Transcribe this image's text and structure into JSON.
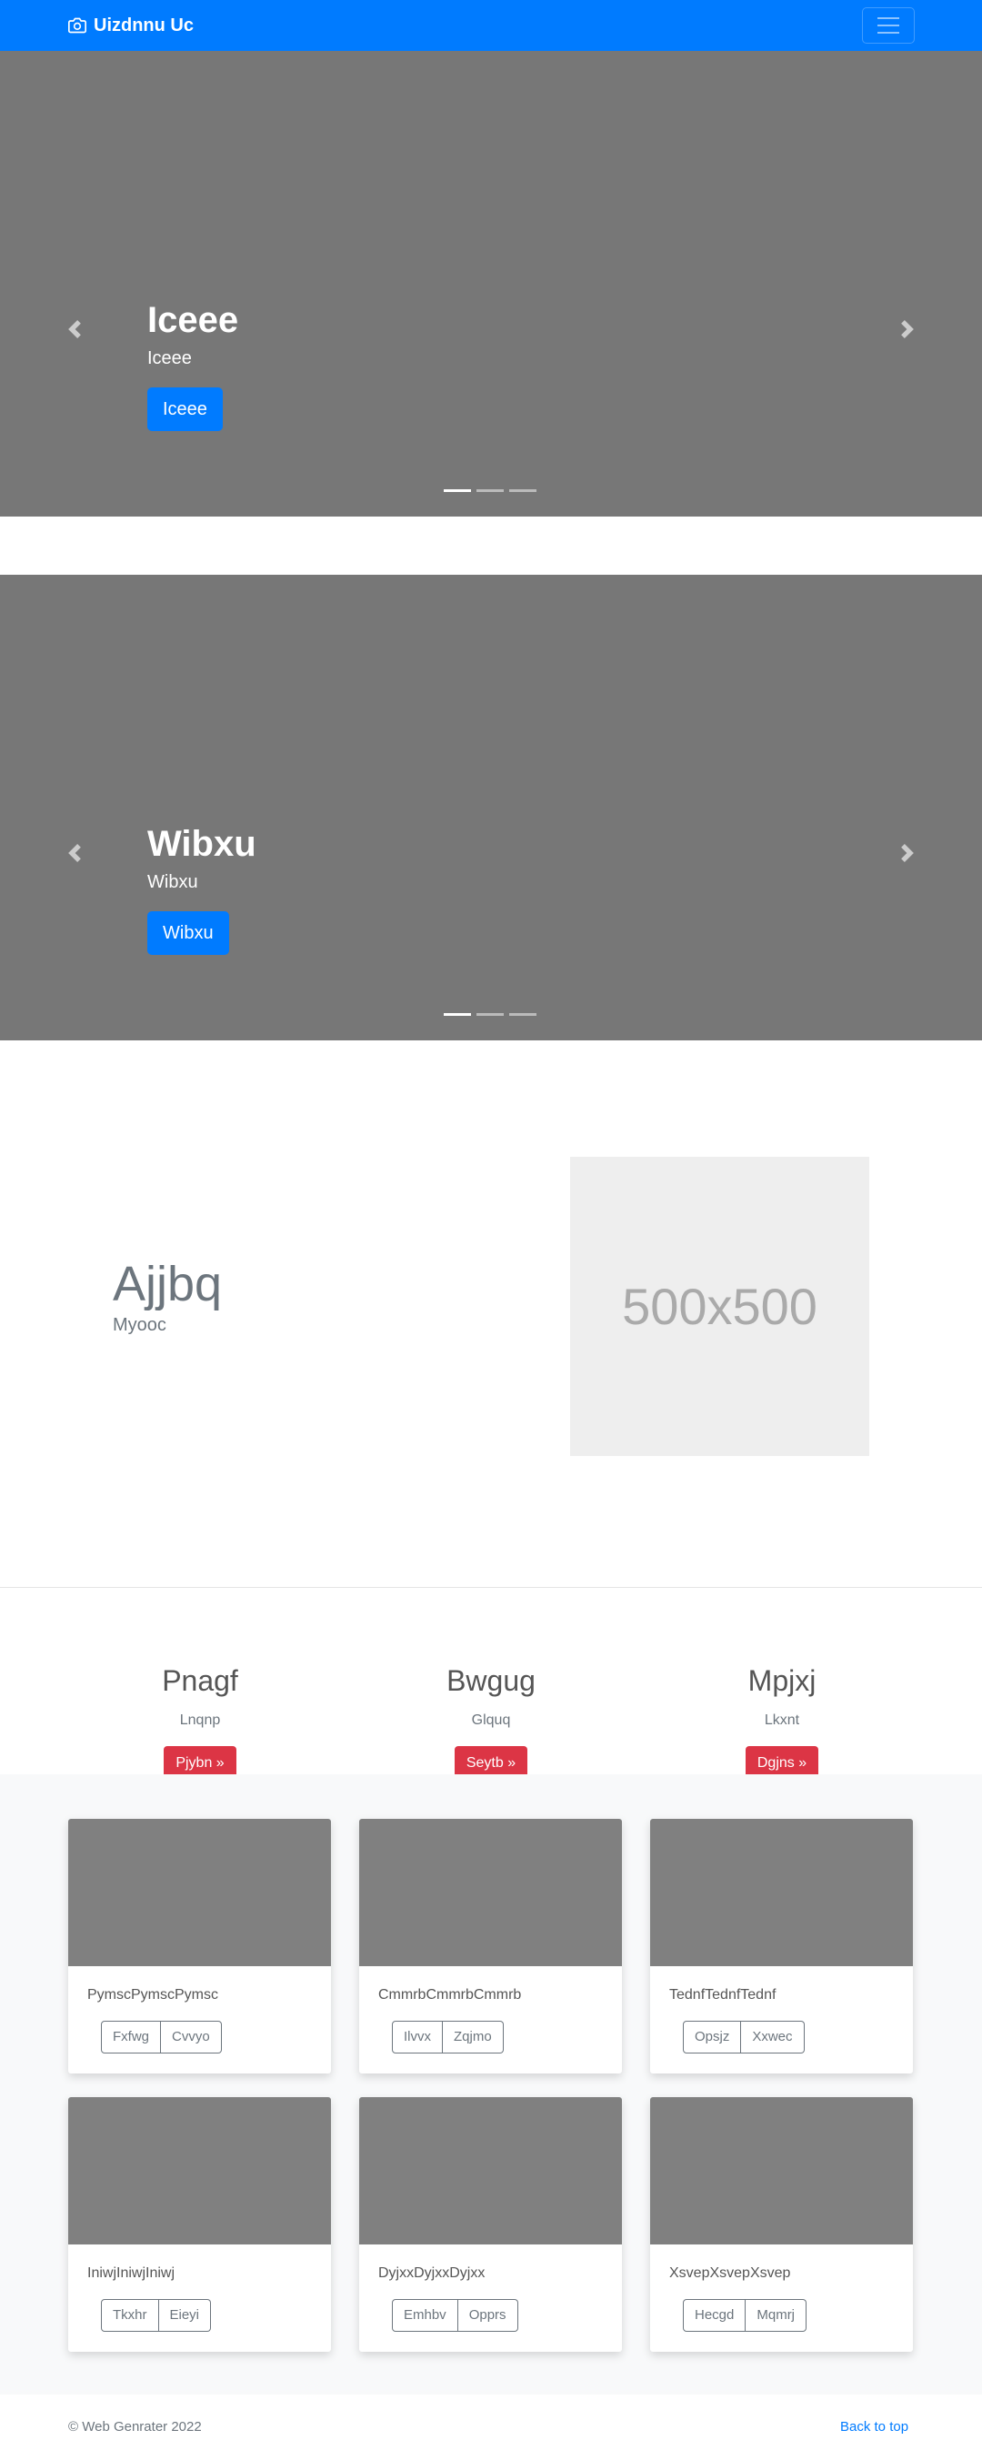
{
  "navbar": {
    "brand": "Uizdnnu Uc",
    "brand_icon": "camera-icon",
    "toggler_icon": "hamburger-menu-icon",
    "bg_color": "#007bff"
  },
  "carousels": [
    {
      "slide_title": "Iceee",
      "slide_subtitle": "Iceee",
      "button_label": "Iceee",
      "active_indicator": 0,
      "indicator_count": 3
    },
    {
      "slide_title": "Wibxu",
      "slide_subtitle": "Wibxu",
      "button_label": "Wibxu",
      "active_indicator": 0,
      "indicator_count": 3
    }
  ],
  "feature": {
    "title": "Ajjbq",
    "subtitle": "Myooc",
    "placeholder_text": "500x500"
  },
  "columns": [
    {
      "title": "Pnagf",
      "text": "Lnqnp",
      "button": "Pjybn »"
    },
    {
      "title": "Bwgug",
      "text": "Glquq",
      "button": "Seytb »"
    },
    {
      "title": "Mpjxj",
      "text": "Lkxnt",
      "button": "Dgjns »"
    }
  ],
  "cards": [
    {
      "text": "PymscPymscPymsc",
      "buttons": [
        "Fxfwg",
        "Cvvyo"
      ]
    },
    {
      "text": "CmmrbCmmrbCmmrb",
      "buttons": [
        "Ilvvx",
        "Zqjmo"
      ]
    },
    {
      "text": "TednfTednfTednf",
      "buttons": [
        "Opsjz",
        "Xxwec"
      ]
    },
    {
      "text": "IniwjIniwjIniwj",
      "buttons": [
        "Tkxhr",
        "Eieyi"
      ]
    },
    {
      "text": "DyjxxDyjxxDyjxx",
      "buttons": [
        "Emhbv",
        "Opprs"
      ]
    },
    {
      "text": "XsvepXsvepXsvep",
      "buttons": [
        "Hecgd",
        "Mqmrj"
      ]
    }
  ],
  "footer": {
    "copyright": "© Web Genrater 2022",
    "back_to_top": "Back to top"
  },
  "colors": {
    "primary": "#007bff",
    "danger": "#dc3545",
    "carousel_bg": "#777777",
    "card_image_bg": "#808080"
  }
}
